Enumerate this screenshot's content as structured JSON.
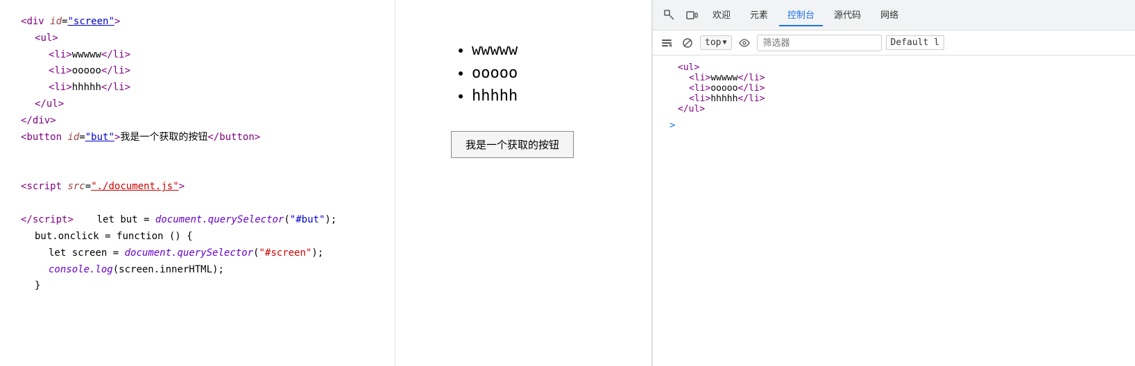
{
  "code_panel": {
    "lines": [
      {
        "indent": 0,
        "content": "div_open"
      },
      {
        "indent": 1,
        "content": "ul_open"
      },
      {
        "indent": 2,
        "content": "li_wwwww"
      },
      {
        "indent": 2,
        "content": "li_ooooo"
      },
      {
        "indent": 2,
        "content": "li_hhhhh"
      },
      {
        "indent": 1,
        "content": "ul_close"
      },
      {
        "indent": 0,
        "content": "div_close"
      },
      {
        "indent": 0,
        "content": "button_line"
      },
      {
        "indent": 0,
        "content": "empty"
      },
      {
        "indent": 0,
        "content": "empty"
      },
      {
        "indent": 0,
        "content": "script_open"
      },
      {
        "indent": 0,
        "content": "empty"
      },
      {
        "indent": 0,
        "content": "script_close"
      },
      {
        "indent": 1,
        "content": "let_but"
      },
      {
        "indent": 1,
        "content": "but_onclick"
      },
      {
        "indent": 2,
        "content": "let_screen"
      },
      {
        "indent": 2,
        "content": "console_log"
      },
      {
        "indent": 1,
        "content": "close_brace"
      }
    ]
  },
  "preview": {
    "list_items": [
      "wwwww",
      "ooooo",
      "hhhhh"
    ],
    "button_text": "我是一个获取的按钮"
  },
  "devtools": {
    "tabs": [
      {
        "label": "欢迎",
        "active": false
      },
      {
        "label": "元素",
        "active": false
      },
      {
        "label": "控制台",
        "active": true
      },
      {
        "label": "源代码",
        "active": false
      },
      {
        "label": "网络",
        "active": false
      }
    ],
    "top_label": "top",
    "filter_placeholder": "筛选器",
    "default_label": "Default l",
    "console_content": [
      {
        "indent": 0,
        "text": "<ul>"
      },
      {
        "indent": 1,
        "text": "<li>wwwww</li>"
      },
      {
        "indent": 1,
        "text": "<li>ooooo</li>"
      },
      {
        "indent": 1,
        "text": "<li>hhhhh</li>"
      },
      {
        "indent": 0,
        "text": "</ul>"
      }
    ]
  }
}
